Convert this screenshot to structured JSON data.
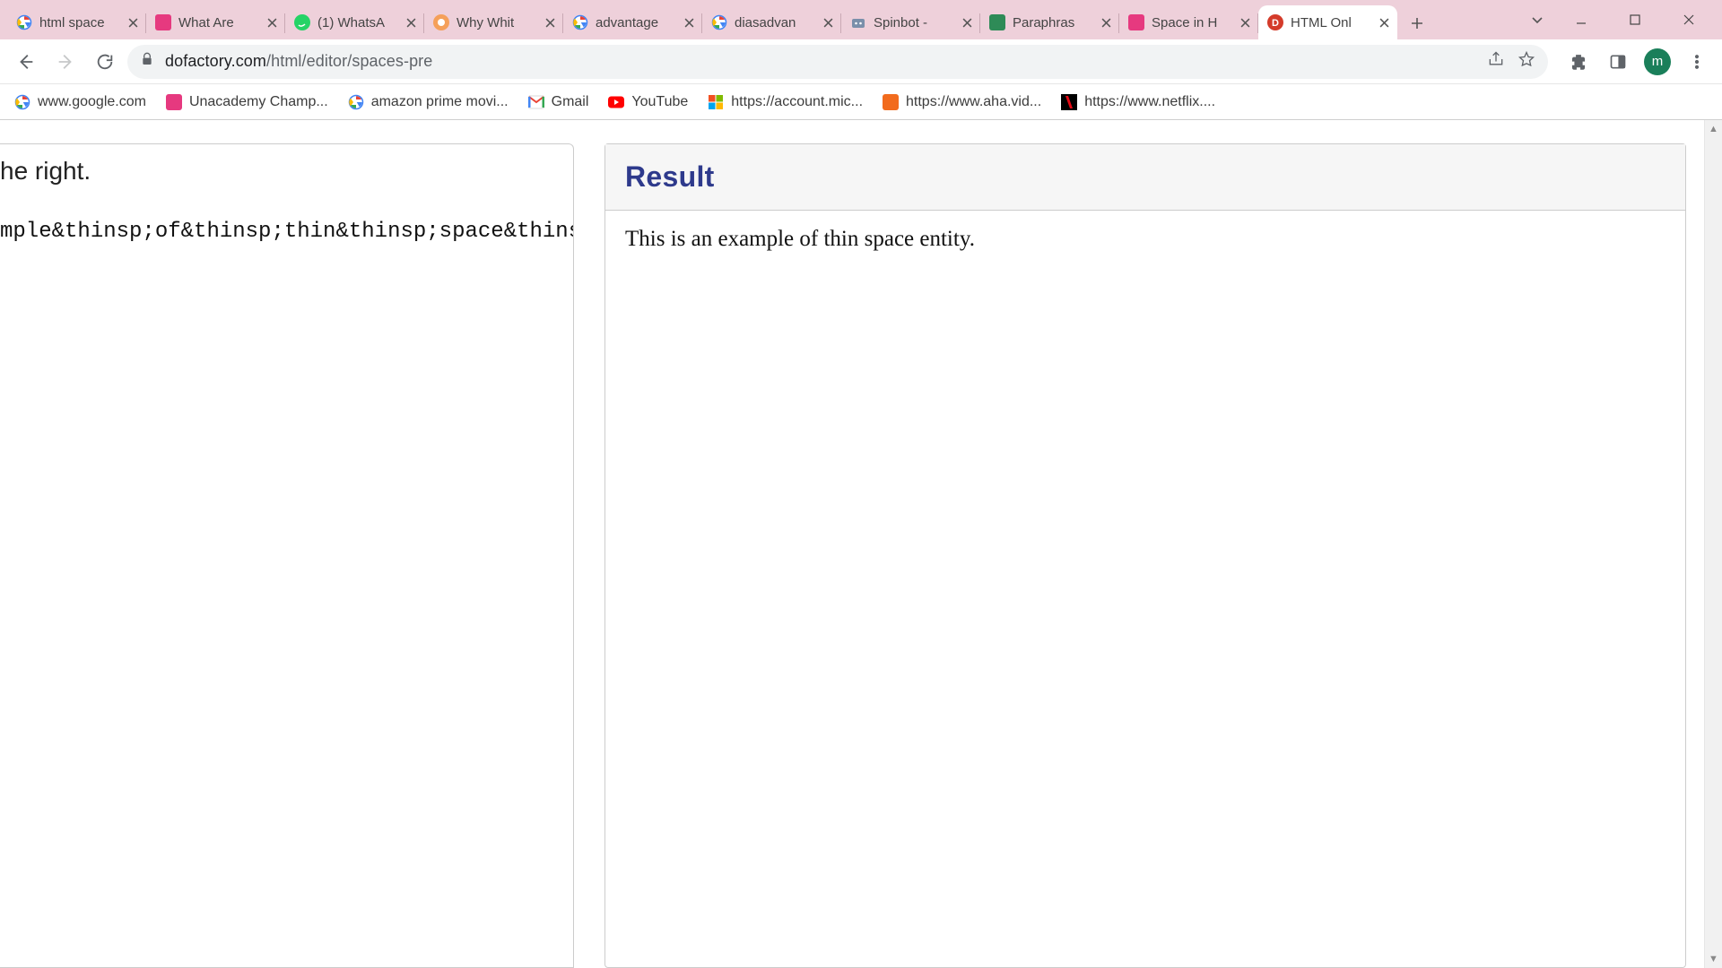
{
  "window": {
    "avatar_initial": "m"
  },
  "tabs": [
    {
      "label": "html space",
      "icon": "google",
      "active": false
    },
    {
      "label": "What Are",
      "icon": "pink-square",
      "active": false
    },
    {
      "label": "(1) WhatsA",
      "icon": "green-circle",
      "active": false
    },
    {
      "label": "Why Whit",
      "icon": "orange-circle",
      "active": false
    },
    {
      "label": "advantage",
      "icon": "google",
      "active": false
    },
    {
      "label": "diasadvan",
      "icon": "google",
      "active": false
    },
    {
      "label": "Spinbot -",
      "icon": "robot",
      "active": false
    },
    {
      "label": "Paraphras",
      "icon": "green-square",
      "active": false
    },
    {
      "label": "Space in H",
      "icon": "pink-square",
      "active": false
    },
    {
      "label": "HTML Onl",
      "icon": "red-circle",
      "active": true
    }
  ],
  "addressbar": {
    "domain": "dofactory.com",
    "path": "/html/editor/spaces-pre"
  },
  "bookmarks": [
    {
      "label": "www.google.com",
      "icon": "google"
    },
    {
      "label": "Unacademy Champ...",
      "icon": "pink-square"
    },
    {
      "label": "amazon prime movi...",
      "icon": "google"
    },
    {
      "label": "Gmail",
      "icon": "gmail"
    },
    {
      "label": "YouTube",
      "icon": "youtube"
    },
    {
      "label": "https://account.mic...",
      "icon": "ms"
    },
    {
      "label": "https://www.aha.vid...",
      "icon": "aha"
    },
    {
      "label": "https://www.netflix....",
      "icon": "netflix"
    }
  ],
  "editor": {
    "source_line1": "he right.",
    "source_line2": "mple&thinsp;of&thinsp;thin&thinsp;space&thinsp",
    "result_heading": "Result",
    "result_text": "This is an example of thin space entity."
  }
}
